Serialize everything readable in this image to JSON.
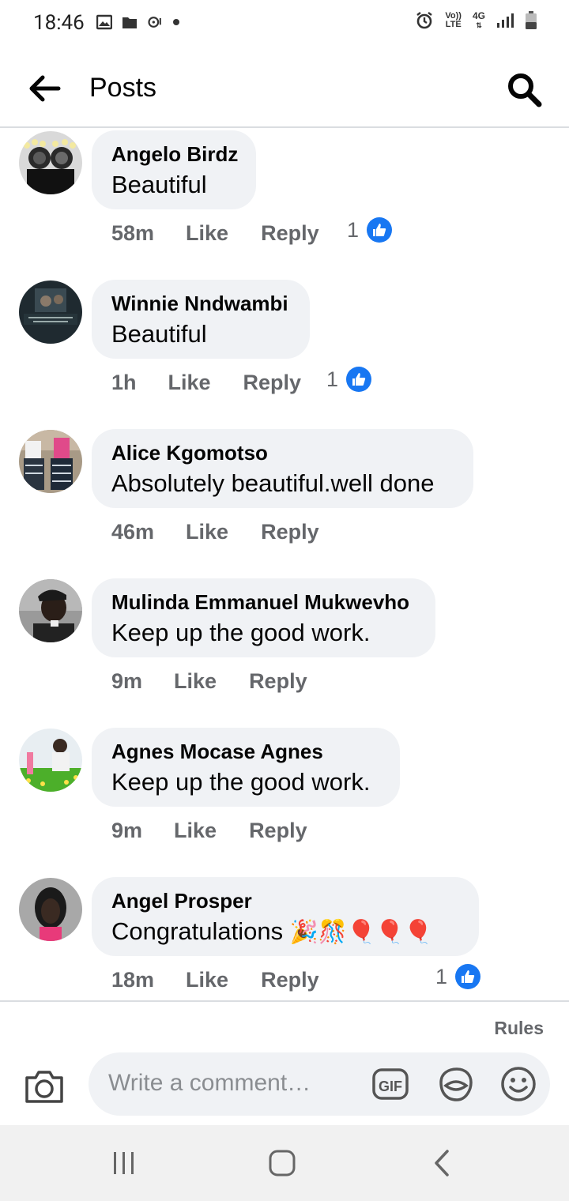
{
  "status_bar": {
    "time": "18:46",
    "left_icons": [
      "gallery-icon",
      "folder-icon",
      "music-record-icon",
      "notification-dot-icon"
    ],
    "right_icons": [
      "alarm-icon",
      "volte-icon",
      "4g-icon",
      "signal-icon",
      "battery-icon"
    ],
    "volte_top": "Vo))",
    "volte_bottom": "LTE",
    "network": "4G"
  },
  "app_bar": {
    "title": "Posts"
  },
  "comments": [
    {
      "author": "Angelo Birdz",
      "text": "Beautiful",
      "time": "58m",
      "like_label": "Like",
      "reply_label": "Reply",
      "reaction_count": "1"
    },
    {
      "author": "Winnie Nndwambi",
      "text": "Beautiful",
      "time": "1h",
      "like_label": "Like",
      "reply_label": "Reply",
      "reaction_count": "1"
    },
    {
      "author": "Alice Kgomotso",
      "text": "Absolutely beautiful.well done",
      "time": "46m",
      "like_label": "Like",
      "reply_label": "Reply",
      "reaction_count": ""
    },
    {
      "author": "Mulinda Emmanuel Mukwevho",
      "text": "Keep up the good work.",
      "time": "9m",
      "like_label": "Like",
      "reply_label": "Reply",
      "reaction_count": ""
    },
    {
      "author": "Agnes Mocase Agnes",
      "text": "Keep up the good work.",
      "time": "9m",
      "like_label": "Like",
      "reply_label": "Reply",
      "reaction_count": ""
    },
    {
      "author": "Angel Prosper",
      "text": "Congratulations",
      "emojis": "🎉🎊🎈🎈🎈",
      "time": "18m",
      "like_label": "Like",
      "reply_label": "Reply",
      "reaction_count": "1"
    }
  ],
  "composer": {
    "rules_label": "Rules",
    "placeholder": "Write a comment…",
    "gif_label": "GIF"
  },
  "colors": {
    "like_blue": "#1877f2",
    "bubble_bg": "#f0f2f5",
    "meta_gray": "#65676b",
    "divider": "#dadde1"
  },
  "nav_bar": {
    "icons": [
      "recent-apps-icon",
      "home-icon",
      "back-nav-icon"
    ]
  }
}
